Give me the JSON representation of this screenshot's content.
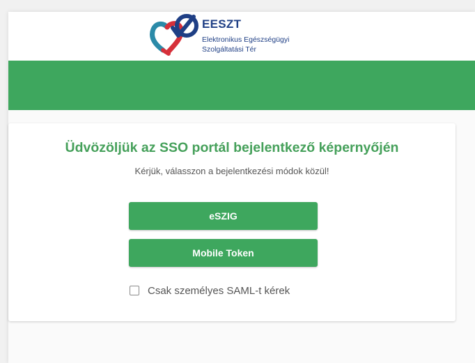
{
  "header": {
    "logo": {
      "title": "EESZT",
      "subtitle_line1": "Elektronikus Egészségügyi",
      "subtitle_line2": "Szolgáltatási Tér"
    }
  },
  "colors": {
    "brand_green": "#3ea75e",
    "title_green": "#45a05a",
    "logo_blue": "#1f3f85",
    "logo_red": "#d6303a",
    "logo_teal": "#2b8aa8"
  },
  "login": {
    "title": "Üdvözöljük az SSO portál bejelentkező képernyőjén",
    "subtitle": "Kérjük, válasszon a bejelentkezési módok közül!",
    "buttons": {
      "eszig": "eSZIG",
      "mobile_token": "Mobile Token"
    },
    "saml_checkbox": {
      "label": "Csak személyes SAML-t kérek",
      "checked": false
    }
  }
}
